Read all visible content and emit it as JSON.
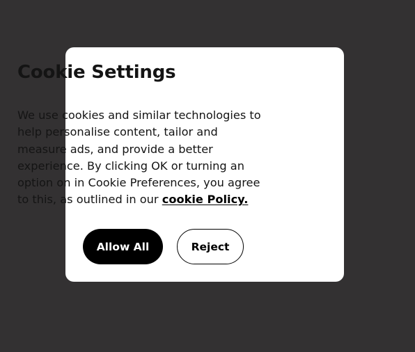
{
  "dialog": {
    "title": "Cookie Settings",
    "body_prefix": "We use cookies and similar technologies to help personalise content, tailor and measure ads, and provide a better experience. By clicking OK or turning an option on in Cookie Preferences, you agree to this, as outlined in our ",
    "policy_link_label": "cookie Policy.",
    "allow_all_label": "Allow All",
    "reject_label": "Reject"
  },
  "colors": {
    "backdrop": "#333132",
    "dialog_background": "#ffffff",
    "primary_button": "#000000",
    "text": "#141414"
  }
}
